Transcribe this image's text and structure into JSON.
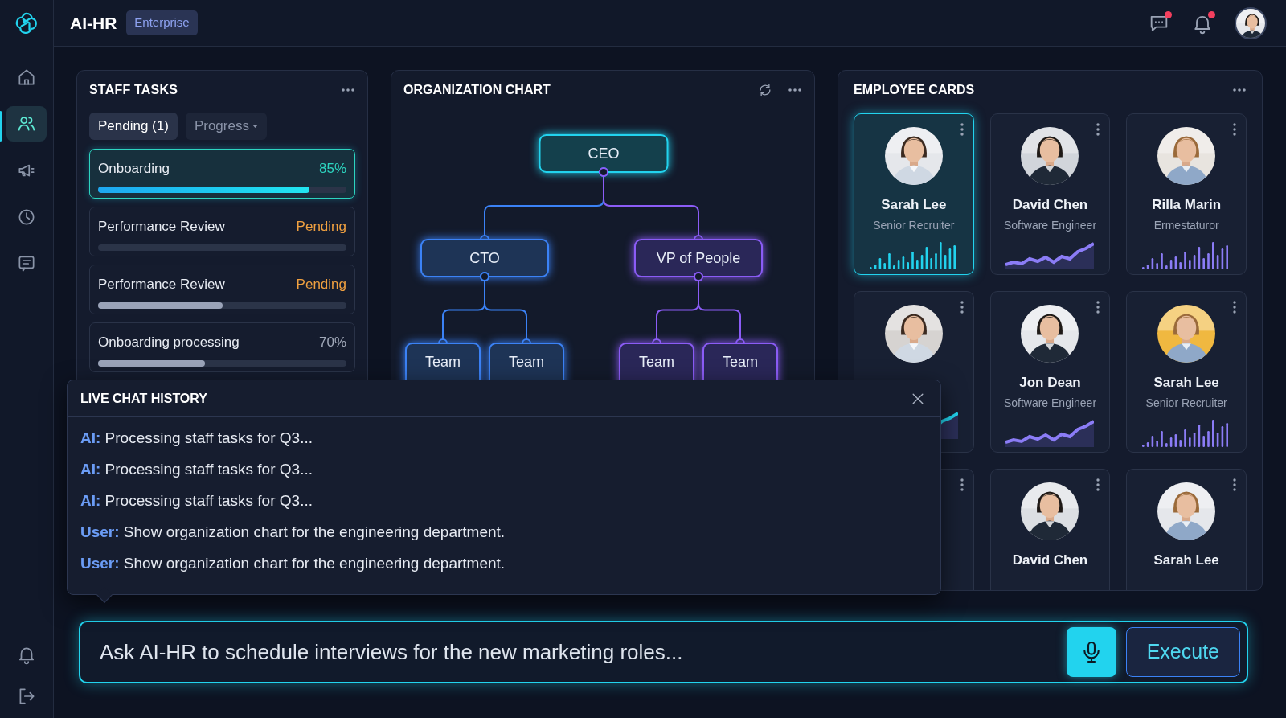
{
  "app": {
    "name": "AI-HR",
    "badge": "Enterprise"
  },
  "header": {
    "messages_unread": true,
    "alerts_unread": true
  },
  "sidebar": {
    "items": [
      {
        "selected": false
      },
      {
        "selected": true
      },
      {
        "selected": false
      },
      {
        "selected": false
      },
      {
        "selected": false
      }
    ]
  },
  "staff_tasks": {
    "title": "STAFF TASKS",
    "tabs": [
      {
        "label": "Pending (1)",
        "selected": true
      },
      {
        "label": "Progress",
        "selected": false
      }
    ],
    "tasks": [
      {
        "name": "Onboarding",
        "status": "85%",
        "kind": "percent",
        "selected": true,
        "level": 0.85
      },
      {
        "name": "Performance Review",
        "status": "Pending",
        "kind": "pending",
        "selected": false,
        "level": 0
      },
      {
        "name": "Performance Review",
        "status": "Pending",
        "kind": "pending",
        "selected": false,
        "level": 0.5
      },
      {
        "name": "Onboarding processing",
        "status": "70%",
        "kind": "percent",
        "selected": false,
        "level": 0.43
      }
    ]
  },
  "org_chart": {
    "title": "ORGANIZATION CHART",
    "root": {
      "label": "CEO",
      "children": [
        {
          "label": "CTO",
          "children": [
            {
              "label": "Team"
            },
            {
              "label": "Team"
            }
          ]
        },
        {
          "label": "VP of People",
          "children": [
            {
              "label": "Team"
            },
            {
              "label": "Team"
            }
          ]
        }
      ]
    }
  },
  "employee_cards": {
    "title": "EMPLOYEE CARDS",
    "cards": [
      {
        "name": "Sarah Lee",
        "role": "Senior Recruiter",
        "selected": true,
        "kind": "bars",
        "color": "#22d3ee"
      },
      {
        "name": "David Chen",
        "role": "Software Engineer",
        "selected": false,
        "kind": "line",
        "color": "#8b7cf6"
      },
      {
        "name": "Rilla Marin",
        "role": "Ermestaturor",
        "selected": false,
        "kind": "bars",
        "color": "#8b7cf6"
      },
      {
        "selected": false,
        "kind": "line",
        "color": "#22d3ee"
      },
      {
        "name": "Jon Dean",
        "role": "Software Engineer",
        "selected": false,
        "kind": "line",
        "color": "#8b7cf6"
      },
      {
        "name": "Sarah Lee",
        "role": "Senior Recruiter",
        "selected": false,
        "kind": "bars",
        "color": "#8b7cf6"
      },
      {
        "selected": false
      },
      {
        "name": "David Chen",
        "selected": false
      },
      {
        "name": "Sarah Lee",
        "selected": false
      }
    ]
  },
  "chat_history": {
    "title": "LIVE CHAT HISTORY",
    "messages": [
      {
        "speaker": "AI:",
        "text": "Processing staff tasks for Q3..."
      },
      {
        "speaker": "AI:",
        "text": "Processing staff tasks for Q3..."
      },
      {
        "speaker": "AI:",
        "text": "Processing staff tasks for Q3..."
      },
      {
        "speaker": "User:",
        "text": "Show organization chart for the engineering department."
      },
      {
        "speaker": "User:",
        "text": "Show organization chart for the engineering department."
      }
    ]
  },
  "command_bar": {
    "placeholder": "Ask AI-HR to schedule interviews for the new marketing roles...",
    "button": "Execute"
  }
}
